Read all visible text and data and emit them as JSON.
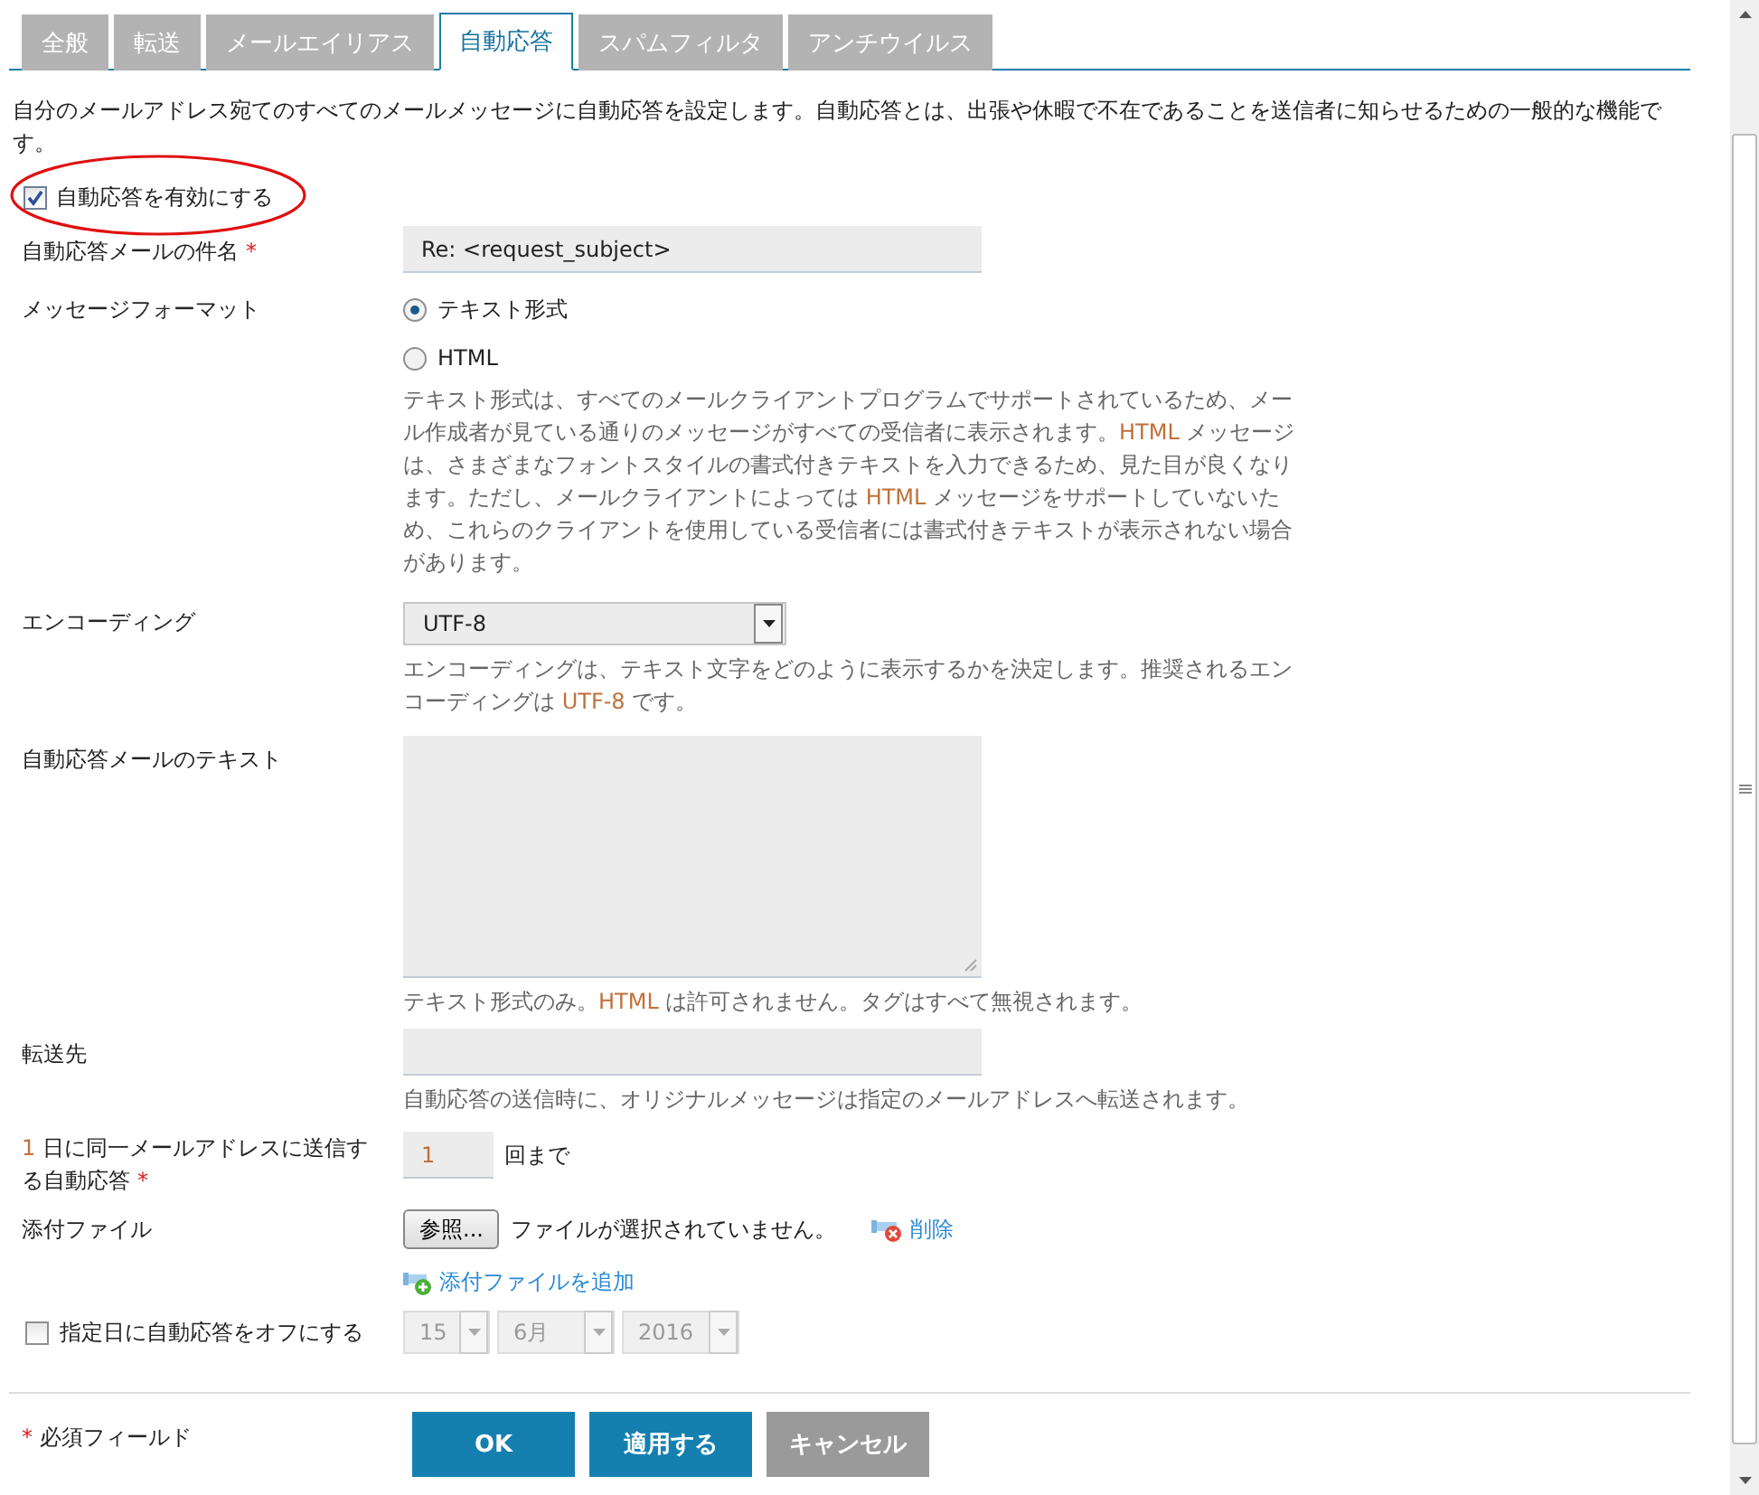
{
  "tabs": [
    {
      "label": "全般",
      "selected": false
    },
    {
      "label": "転送",
      "selected": false
    },
    {
      "label": "メールエイリアス",
      "selected": false
    },
    {
      "label": "自動応答",
      "selected": true
    },
    {
      "label": "スパムフィルタ",
      "selected": false
    },
    {
      "label": "アンチウイルス",
      "selected": false
    }
  ],
  "intro": "自分のメールアドレス宛てのすべてのメールメッセージに自動応答を設定します。自動応答とは、出張や休暇で不在であることを送信者に知らせるための一般的な機能です。",
  "enable": {
    "label": "自動応答を有効にする",
    "checked": true,
    "circled": true
  },
  "fields": [
    {
      "kind": "text",
      "label": [
        {
          "text": "自動応答メールの件名",
          "highlight": false
        }
      ],
      "required_mark": "*",
      "value": "Re: <request_subject>"
    },
    {
      "kind": "radio",
      "label": [
        {
          "text": "メッセージフォーマット",
          "highlight": false
        }
      ],
      "options": [
        {
          "label": "テキスト形式",
          "selected": true
        },
        {
          "label": "HTML",
          "selected": false
        }
      ],
      "help": [
        {
          "text": "テキスト形式は、すべてのメールクライアントプログラムでサポートされているため、メール作成者が見ている通りのメッセージがすべての受信者に表示されます。",
          "highlight": false
        },
        {
          "text": "HTML",
          "highlight": true
        },
        {
          "text": " メッセージは、さまざまなフォントスタイルの書式付きテキストを入力できるため、見た目が良くなります。ただし、メールクライアントによっては ",
          "highlight": false
        },
        {
          "text": "HTML",
          "highlight": true
        },
        {
          "text": " メッセージをサポートしていないため、これらのクライアントを使用している受信者には書式付きテキストが表示されない場合があります。",
          "highlight": false
        }
      ]
    },
    {
      "kind": "select",
      "label": [
        {
          "text": "エンコーディング",
          "highlight": false
        }
      ],
      "value": "UTF-8",
      "help": [
        {
          "text": "エンコーディングは、テキスト文字をどのように表示するかを決定します。推奨されるエンコーディングは ",
          "highlight": false
        },
        {
          "text": "UTF-8",
          "highlight": true
        },
        {
          "text": " です。",
          "highlight": false
        }
      ]
    },
    {
      "kind": "textarea",
      "label": [
        {
          "text": "自動応答メールのテキスト",
          "highlight": false
        }
      ],
      "help": [
        {
          "text": "テキスト形式のみ。",
          "highlight": false
        },
        {
          "text": "HTML",
          "highlight": true
        },
        {
          "text": " は許可されません。タグはすべて無視されます。",
          "highlight": false
        }
      ]
    },
    {
      "kind": "text",
      "label": [
        {
          "text": "転送先",
          "highlight": false
        }
      ],
      "help": [
        {
          "text": "自動応答の送信時に、オリジナルメッセージは指定のメールアドレスへ転送されます。",
          "highlight": false
        }
      ]
    },
    {
      "kind": "count",
      "label": [
        {
          "text": "1",
          "highlight": true
        },
        {
          "text": " 日に同一メールアドレスに送信する自動応答",
          "highlight": false
        }
      ],
      "required_mark": "*",
      "value": "1",
      "suffix": "回まで"
    },
    {
      "kind": "file",
      "label": [
        {
          "text": "添付ファイル",
          "highlight": false
        }
      ],
      "browse": "参照...",
      "status": "ファイルが選択されていません。",
      "remove": "削除",
      "add": "添付ファイルを追加"
    },
    {
      "kind": "date",
      "check_label": "指定日に自動応答をオフにする",
      "checked": false,
      "disabled": true,
      "day": "15",
      "month": "6月",
      "year": "2016"
    }
  ],
  "footer": {
    "required_mark": "*",
    "note": "必須フィールド",
    "buttons": [
      {
        "label": "OK",
        "kind": "primary"
      },
      {
        "label": "適用する",
        "kind": "primary"
      },
      {
        "label": "キャンセル",
        "kind": "secondary"
      }
    ]
  }
}
